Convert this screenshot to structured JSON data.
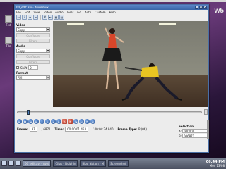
{
  "desktop": {
    "icons": [
      {
        "label": "Fed",
        "icon": "file-icon"
      },
      {
        "label": "File",
        "icon": "file-icon"
      }
    ],
    "brand": "w5"
  },
  "window": {
    "title": "00_edit.avi - Avidemux",
    "menu": [
      "File",
      "Edit",
      "View",
      "Video",
      "Audio",
      "Tools",
      "Go",
      "Auto",
      "Custom",
      "Help"
    ],
    "sidebar": {
      "video_label": "Video",
      "video_codec": "Copy",
      "video_configure": "Configure",
      "video_filters": "Filters",
      "audio_label": "Audio",
      "audio_codec": "Copy",
      "audio_configure": "Configure",
      "audio_filters": "Filters",
      "shift_label": "Shift",
      "shift_value": "0",
      "format_label": "Format",
      "format_value": "AVI"
    },
    "status": {
      "frame_label": "Frame:",
      "frame_value": "37",
      "frame_total": "/ 6871",
      "time_label": "Time:",
      "time_value": "00:00:01.453",
      "time_total": "/ 00:04:34.840",
      "frame_type_label": "Frame Type:",
      "frame_type_value": "P (06)"
    },
    "selection": {
      "header": "Selection",
      "a_label": "A:",
      "a_value": "000000",
      "b_label": "B:",
      "b_value": "006871"
    },
    "timeline_progress": 0.05
  },
  "taskbar": {
    "tasks": [
      {
        "label": "00_edit.avi - Avid",
        "active": true
      },
      {
        "label": "Clips - Dolphin",
        "active": false
      },
      {
        "label": "Blog Nation - M",
        "active": false
      },
      {
        "label": "Screenshot",
        "active": false
      }
    ],
    "clock_time": "06:44 PM",
    "clock_date": "Mon 13/08"
  }
}
